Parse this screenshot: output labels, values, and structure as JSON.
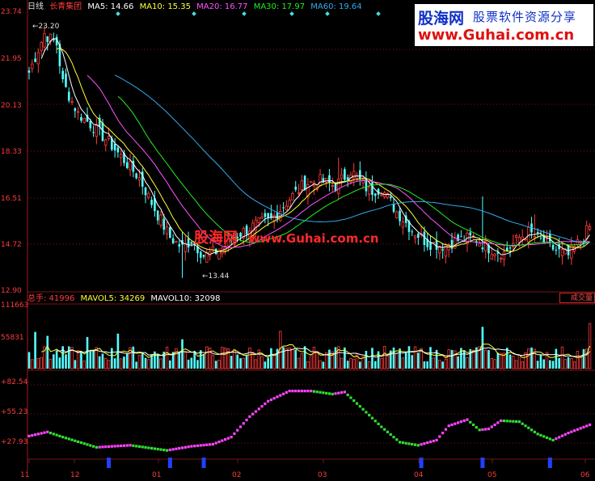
{
  "main_header": {
    "period": "日线",
    "stock_name": "长青集团",
    "ma5": "MA5: 14.66",
    "ma10": "MA10: 15.35",
    "ma20": "MA20: 16.77",
    "ma30": "MA30: 17.97",
    "ma60": "MA60: 19.64"
  },
  "volume_header": {
    "total": "总手: 41996",
    "mavol5": "MAVOL5: 34269",
    "mavol10": "MAVOL10: 32098"
  },
  "volume_button": "成交量",
  "price_axis_labels": [
    "23.74",
    "21.95",
    "20.13",
    "18.33",
    "16.51",
    "14.72",
    "12.90"
  ],
  "volume_axis_labels": [
    "111663",
    "55831"
  ],
  "indicator_axis_labels": [
    "+82.54",
    "+55.23",
    "+27.93"
  ],
  "x_axis_labels": [
    "11",
    "12",
    "01",
    "02",
    "03",
    "04",
    "05",
    "06"
  ],
  "price_annotations": {
    "high": "23.20",
    "low": "13.44"
  },
  "watermark": {
    "site_cn": "股海网",
    "site_url": "www.Guhai.com.cn"
  },
  "logo": {
    "name": "股海网",
    "tagline": "股票软件资源分享",
    "url": "www.Guhai.com.cn"
  },
  "colors": {
    "up": "#ff3b3b",
    "down": "#54ffff",
    "ma5": "#ffffff",
    "ma10": "#ffff33",
    "ma20": "#ff55ff",
    "ma30": "#22ee22",
    "ma60": "#33aaee",
    "ind_up": "#ff44ff",
    "ind_down": "#33dd33",
    "marker": "#2040ff",
    "grid": "#7a1515"
  },
  "chart_data": {
    "type": "candlestick",
    "price_range": [
      12.9,
      23.74
    ],
    "volume_range": [
      0,
      111663
    ],
    "indicator_range": [
      15,
      90
    ],
    "anchors": [
      [
        0,
        21.4
      ],
      [
        5,
        22.9
      ],
      [
        9,
        22.5
      ],
      [
        11,
        21.0
      ],
      [
        16,
        19.8
      ],
      [
        21,
        19.3
      ],
      [
        26,
        18.7
      ],
      [
        31,
        18.0
      ],
      [
        36,
        17.3
      ],
      [
        41,
        16.1
      ],
      [
        46,
        15.0
      ],
      [
        50,
        14.6
      ],
      [
        53,
        14.9
      ],
      [
        57,
        14.3
      ],
      [
        62,
        14.5
      ],
      [
        68,
        15.1
      ],
      [
        74,
        15.5
      ],
      [
        79,
        15.7
      ],
      [
        85,
        16.5
      ],
      [
        90,
        17.1
      ],
      [
        95,
        17.2
      ],
      [
        100,
        17.0
      ],
      [
        105,
        17.6
      ],
      [
        108,
        17.2
      ],
      [
        111,
        16.8
      ],
      [
        115,
        16.9
      ],
      [
        120,
        16.0
      ],
      [
        125,
        15.3
      ],
      [
        130,
        14.8
      ],
      [
        135,
        14.7
      ],
      [
        140,
        14.9
      ],
      [
        145,
        15.0
      ],
      [
        150,
        14.6
      ],
      [
        155,
        14.4
      ],
      [
        160,
        15.0
      ],
      [
        163,
        15.2
      ],
      [
        167,
        14.9
      ],
      [
        172,
        14.5
      ],
      [
        176,
        14.3
      ],
      [
        180,
        14.9
      ],
      [
        183,
        15.4
      ]
    ],
    "special_bars": [
      {
        "i": 5,
        "high": 23.2
      },
      {
        "i": 50,
        "low": 13.44
      },
      {
        "i": 101,
        "high": 18.1
      },
      {
        "i": 148,
        "high": 16.6
      },
      {
        "i": 165,
        "high": 15.9
      }
    ],
    "volume_spikes": [
      {
        "i": 2,
        "v": 65000
      },
      {
        "i": 6,
        "v": 58000
      },
      {
        "i": 19,
        "v": 56000
      },
      {
        "i": 29,
        "v": 62000
      },
      {
        "i": 50,
        "v": 52000
      },
      {
        "i": 82,
        "v": 66000
      },
      {
        "i": 100,
        "v": 38000
      },
      {
        "i": 148,
        "v": 74000
      },
      {
        "i": 183,
        "v": 80000
      }
    ],
    "indicator_anchors": [
      [
        0,
        36
      ],
      [
        6,
        40
      ],
      [
        11,
        35
      ],
      [
        22,
        25
      ],
      [
        33,
        27
      ],
      [
        45,
        22
      ],
      [
        53,
        26
      ],
      [
        60,
        28
      ],
      [
        66,
        35
      ],
      [
        72,
        55
      ],
      [
        78,
        70
      ],
      [
        85,
        80
      ],
      [
        92,
        80
      ],
      [
        99,
        77
      ],
      [
        103,
        79
      ],
      [
        108,
        65
      ],
      [
        115,
        45
      ],
      [
        121,
        30
      ],
      [
        127,
        27
      ],
      [
        133,
        32
      ],
      [
        137,
        46
      ],
      [
        143,
        52
      ],
      [
        147,
        42
      ],
      [
        150,
        43
      ],
      [
        154,
        51
      ],
      [
        160,
        50
      ],
      [
        166,
        38
      ],
      [
        171,
        32
      ],
      [
        176,
        39
      ],
      [
        183,
        47
      ]
    ],
    "markers": [
      26,
      46,
      57,
      128,
      148,
      170
    ]
  }
}
